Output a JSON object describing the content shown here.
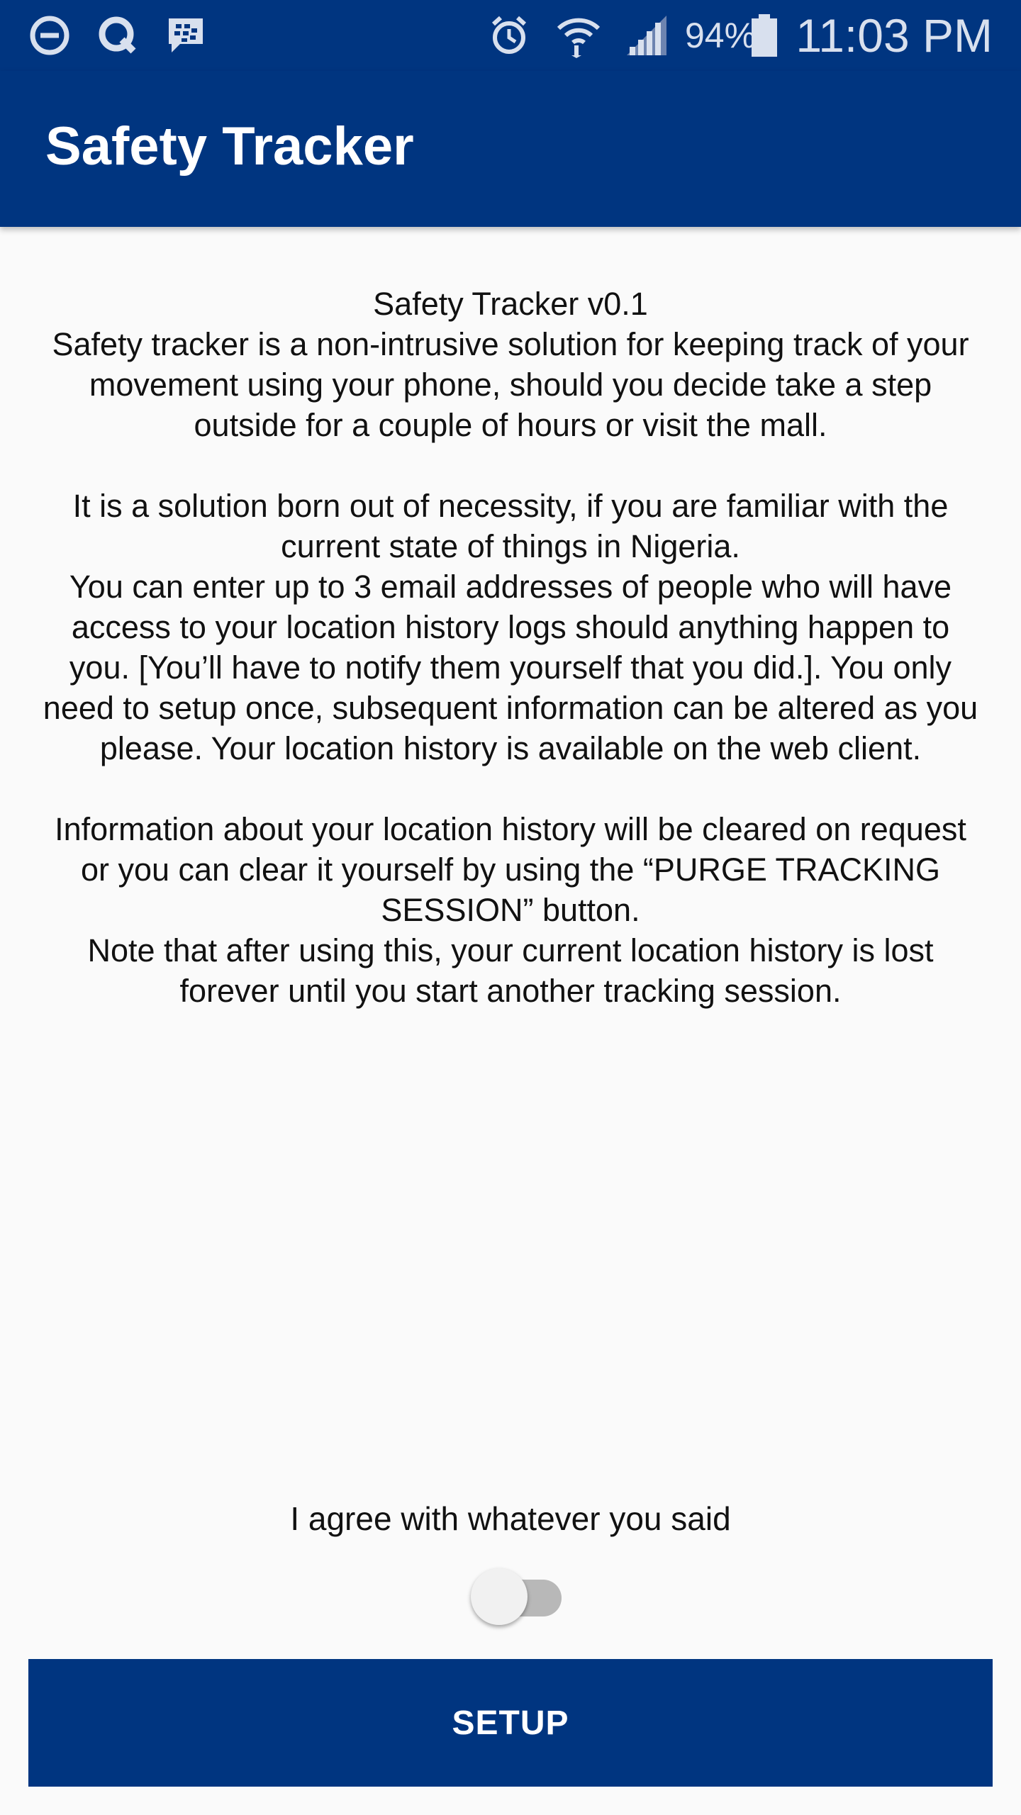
{
  "status_bar": {
    "battery_percent": "94%",
    "time": "11:03 PM",
    "icons": [
      "do-not-disturb-icon",
      "q-app-icon",
      "bbm-icon",
      "alarm-icon",
      "wifi-icon",
      "signal-icon",
      "battery-icon"
    ]
  },
  "app_bar": {
    "title": "Safety Tracker"
  },
  "intro": {
    "heading": "Safety Tracker v0.1",
    "p1": "Safety tracker is a non-intrusive solution for keeping track of your movement using your phone, should you decide take a step outside for a couple of hours or visit the mall.",
    "p2": "It is a solution born out of necessity, if you are familiar with the current state of things in Nigeria.",
    "p3": "You can enter up to 3 email addresses of people who will have access to your location history logs should anything happen to you. [You’ll have to notify them yourself that you did.]. You only need to setup once, subsequent information can be altered as you please. Your location history is available on the web client.",
    "p4": "Information about your location history will be cleared on request or you can clear it yourself by using the “PURGE TRACKING SESSION” button.",
    "p5": "Note that after using this, your current location history is lost forever until you start another tracking session."
  },
  "agreement": {
    "label": "I agree with whatever you said",
    "checked": false
  },
  "setup_button": {
    "label": "SETUP"
  },
  "colors": {
    "primary": "#003580",
    "background": "#fafafa"
  }
}
